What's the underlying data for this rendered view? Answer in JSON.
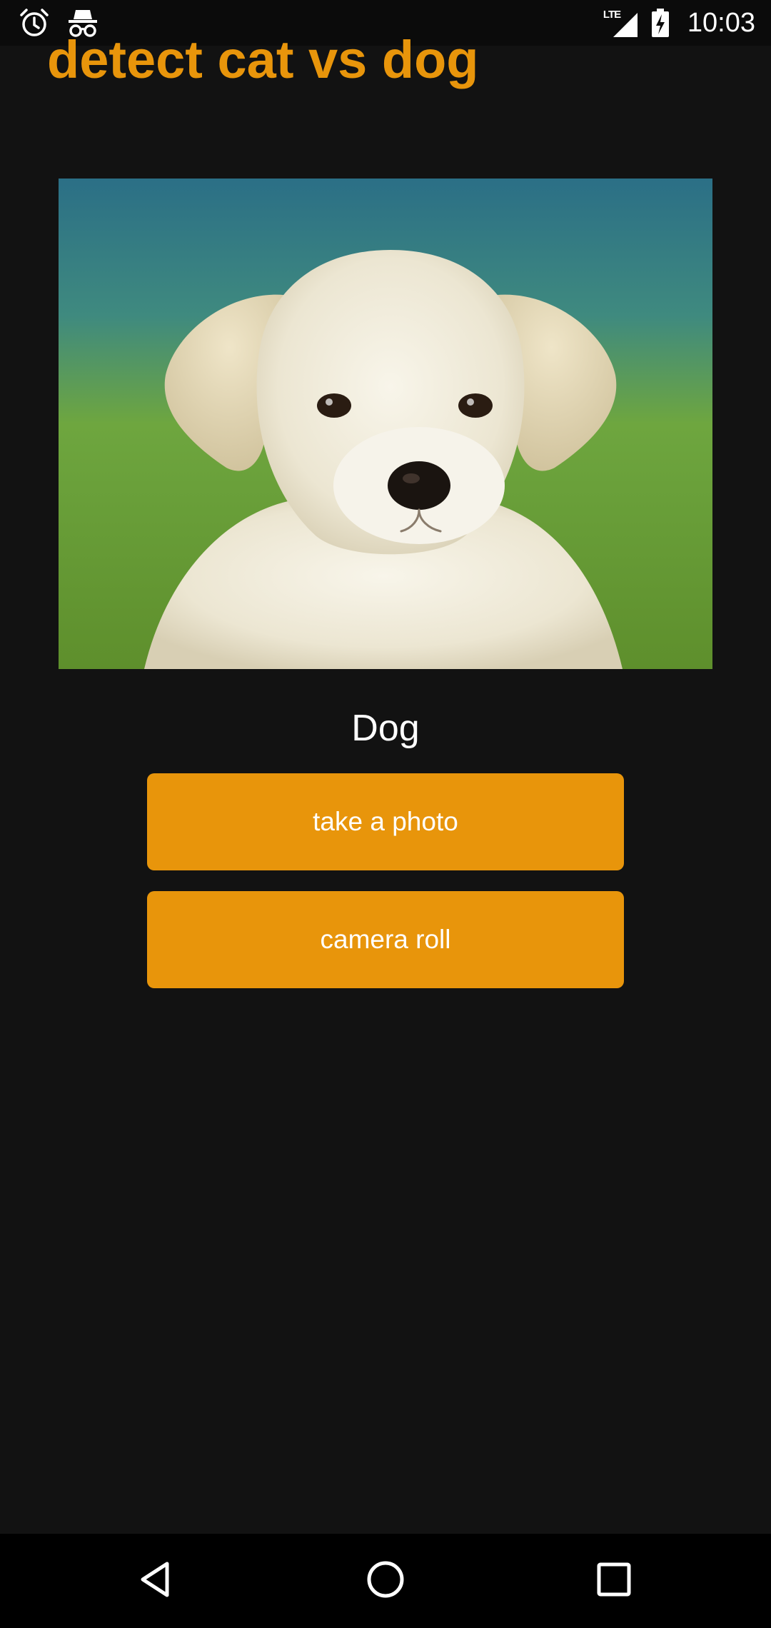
{
  "status_bar": {
    "time": "10:03",
    "network": "LTE",
    "icons": [
      "alarm-icon",
      "incognito-icon",
      "lte-signal-icon",
      "battery-charging-icon"
    ]
  },
  "app": {
    "title": "detect cat vs dog",
    "result": "Dog",
    "buttons": {
      "take_photo": "take a photo",
      "camera_roll": "camera roll"
    }
  },
  "nav_bar": {
    "icons": [
      "back-icon",
      "home-icon",
      "recents-icon"
    ]
  },
  "colors": {
    "accent": "#e8950b",
    "background": "#121212",
    "text": "#ffffff",
    "nav_background": "#000000"
  }
}
